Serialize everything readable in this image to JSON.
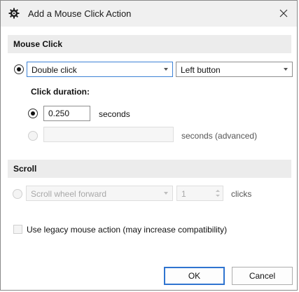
{
  "window": {
    "title": "Add a Mouse Click Action",
    "icon": "gear-icon",
    "close_icon": "close-icon"
  },
  "mouse_click": {
    "header": "Mouse Click",
    "click_type": {
      "value": "Double click",
      "selected": true
    },
    "button": {
      "value": "Left button"
    },
    "duration_label": "Click duration:",
    "duration": {
      "value": "0.250",
      "unit": "seconds",
      "selected": true
    },
    "advanced": {
      "value": "",
      "unit": "seconds (advanced)",
      "selected": false
    }
  },
  "scroll": {
    "header": "Scroll",
    "direction": {
      "value": "Scroll wheel forward"
    },
    "clicks": {
      "value": "1",
      "unit": "clicks"
    }
  },
  "legacy": {
    "label": "Use legacy mouse action (may increase compatibility)",
    "checked": false
  },
  "buttons": {
    "ok": "OK",
    "cancel": "Cancel"
  },
  "colors": {
    "accent": "#3d82d6",
    "header_band": "#ececec",
    "titlebar": "#f0f0f0"
  }
}
